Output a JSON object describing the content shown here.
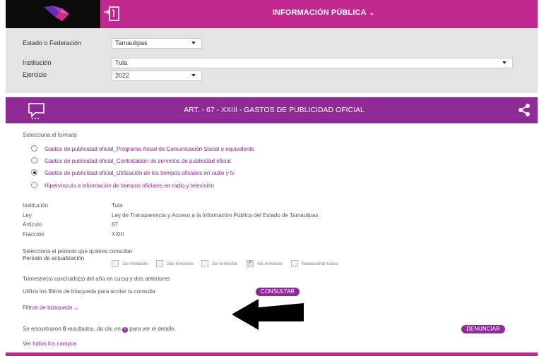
{
  "header": {
    "title": "INFORMACIÓN PÚBLICA",
    "colors": {
      "topbar": "#c0288f",
      "logo_bg": "#0b0b0b",
      "banner": "#8e2a95"
    }
  },
  "filters": {
    "estado_label": "Estado o Federación",
    "estado_value": "Tamaulipas",
    "institucion_label": "Institución",
    "institucion_value": "Tula",
    "ejercicio_label": "Ejercicio",
    "ejercicio_value": "2022"
  },
  "banner": {
    "title": "ART. - 67 - XXIII - GASTOS DE PUBLICIDAD OFICIAL"
  },
  "format": {
    "prompt": "Selecciona el formato",
    "options": [
      {
        "label": "Gastos de publicidad oficial_Programa Anual de Comunicación Social o equivalente",
        "selected": false
      },
      {
        "label": "Gastos de publicidad oficial_Contratación de servicios de publicidad oficial",
        "selected": false
      },
      {
        "label": "Gastos de publicidad oficial_Utilización de los tiempos oficiales en radio y tv",
        "selected": true
      },
      {
        "label": "Hipervínculo a información de tiempos oficiales en radio y televisión",
        "selected": false
      }
    ]
  },
  "info": {
    "institucion_label": "Institución",
    "institucion_value": "Tula",
    "ley_label": "Ley",
    "ley_value": "Ley de Transparencia y Acceso a la Información Pública del Estado de Tamaulipas",
    "articulo_label": "Artículo",
    "articulo_value": "67",
    "fraccion_label": "Fracción",
    "fraccion_value": "XXIII"
  },
  "period": {
    "prompt": "Selecciona el periodo que quieres consultar",
    "label": "Periodo de actualización",
    "checkboxes": [
      {
        "label": "1er trimestre",
        "checked": false
      },
      {
        "label": "2do trimestre",
        "checked": false
      },
      {
        "label": "3er trimestre",
        "checked": false
      },
      {
        "label": "4to trimestre",
        "checked": true
      },
      {
        "label": "Seleccionar todos",
        "checked": false
      }
    ],
    "note": "Trimestre(s) concluido(s) del año en curso y dos anteriores"
  },
  "search": {
    "hint": "Utiliza los filtros de búsqueda para acotar tu consulta",
    "consultar": "CONSULTAR",
    "filtros": "Filtros de búsqueda",
    "result_prefix": "Se encontraron",
    "result_count": "0",
    "result_mid": "resultados, da clic en",
    "result_suffix": "para ver el detalle.",
    "denunciar": "DENUNCIAR",
    "ver_todos": "Ver todos los campos"
  }
}
